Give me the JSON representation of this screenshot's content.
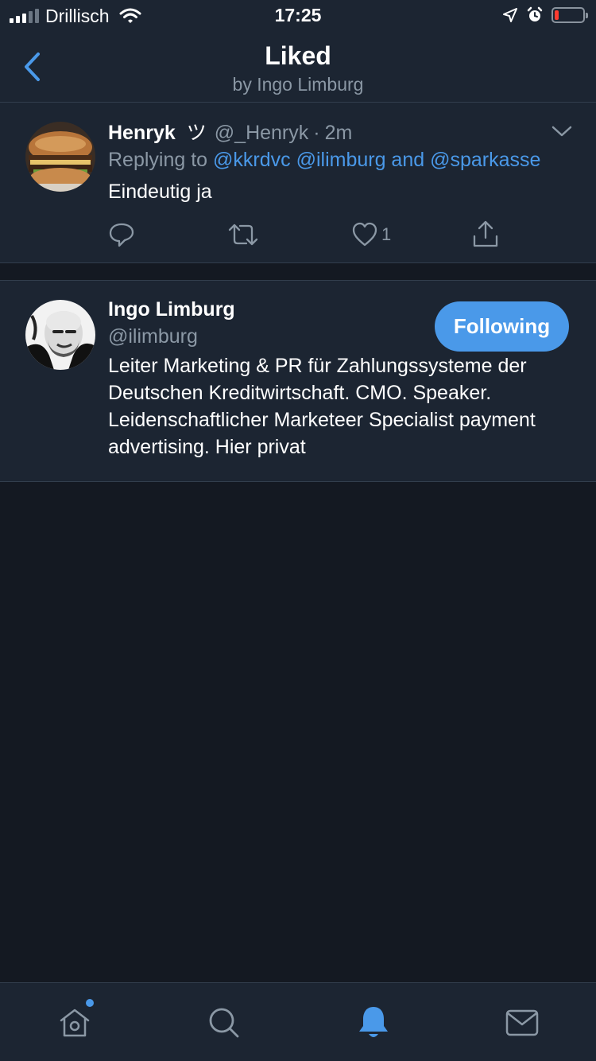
{
  "status_bar": {
    "carrier": "Drillisch",
    "time": "17:25",
    "battery_level": 0.15,
    "battery_color": "#ff3b30"
  },
  "header": {
    "title": "Liked",
    "subtitle": "by Ingo Limburg",
    "back_icon": "chevron-left-icon"
  },
  "tweet": {
    "author_name": "Henryk",
    "author_emoji": "ツ",
    "handle": "@_Henryk",
    "separator": "·",
    "time_ago": "2m",
    "replying_prefix": "Replying to",
    "replying_to": "@kkrdvc @ilimburg and @sparkasse",
    "text": "Eindeutig ja",
    "like_count": "1",
    "actions": [
      "reply-icon",
      "retweet-icon",
      "like-icon",
      "share-icon"
    ]
  },
  "profile": {
    "name": "Ingo Limburg",
    "handle": "@ilimburg",
    "follow_label": "Following",
    "bio": "Leiter Marketing & PR für Zahlungssysteme der Deutschen Kreditwirtschaft. CMO. Speaker. Leidenschaftlicher Marketeer Specialist payment advertising. Hier privat"
  },
  "tab_bar": {
    "tabs": [
      "home-icon",
      "search-icon",
      "notifications-icon",
      "messages-icon"
    ],
    "active": "notifications-icon"
  },
  "colors": {
    "accent": "#4a99e9",
    "background": "#141922",
    "surface": "#1c2532",
    "muted_text": "#8b98a5"
  }
}
